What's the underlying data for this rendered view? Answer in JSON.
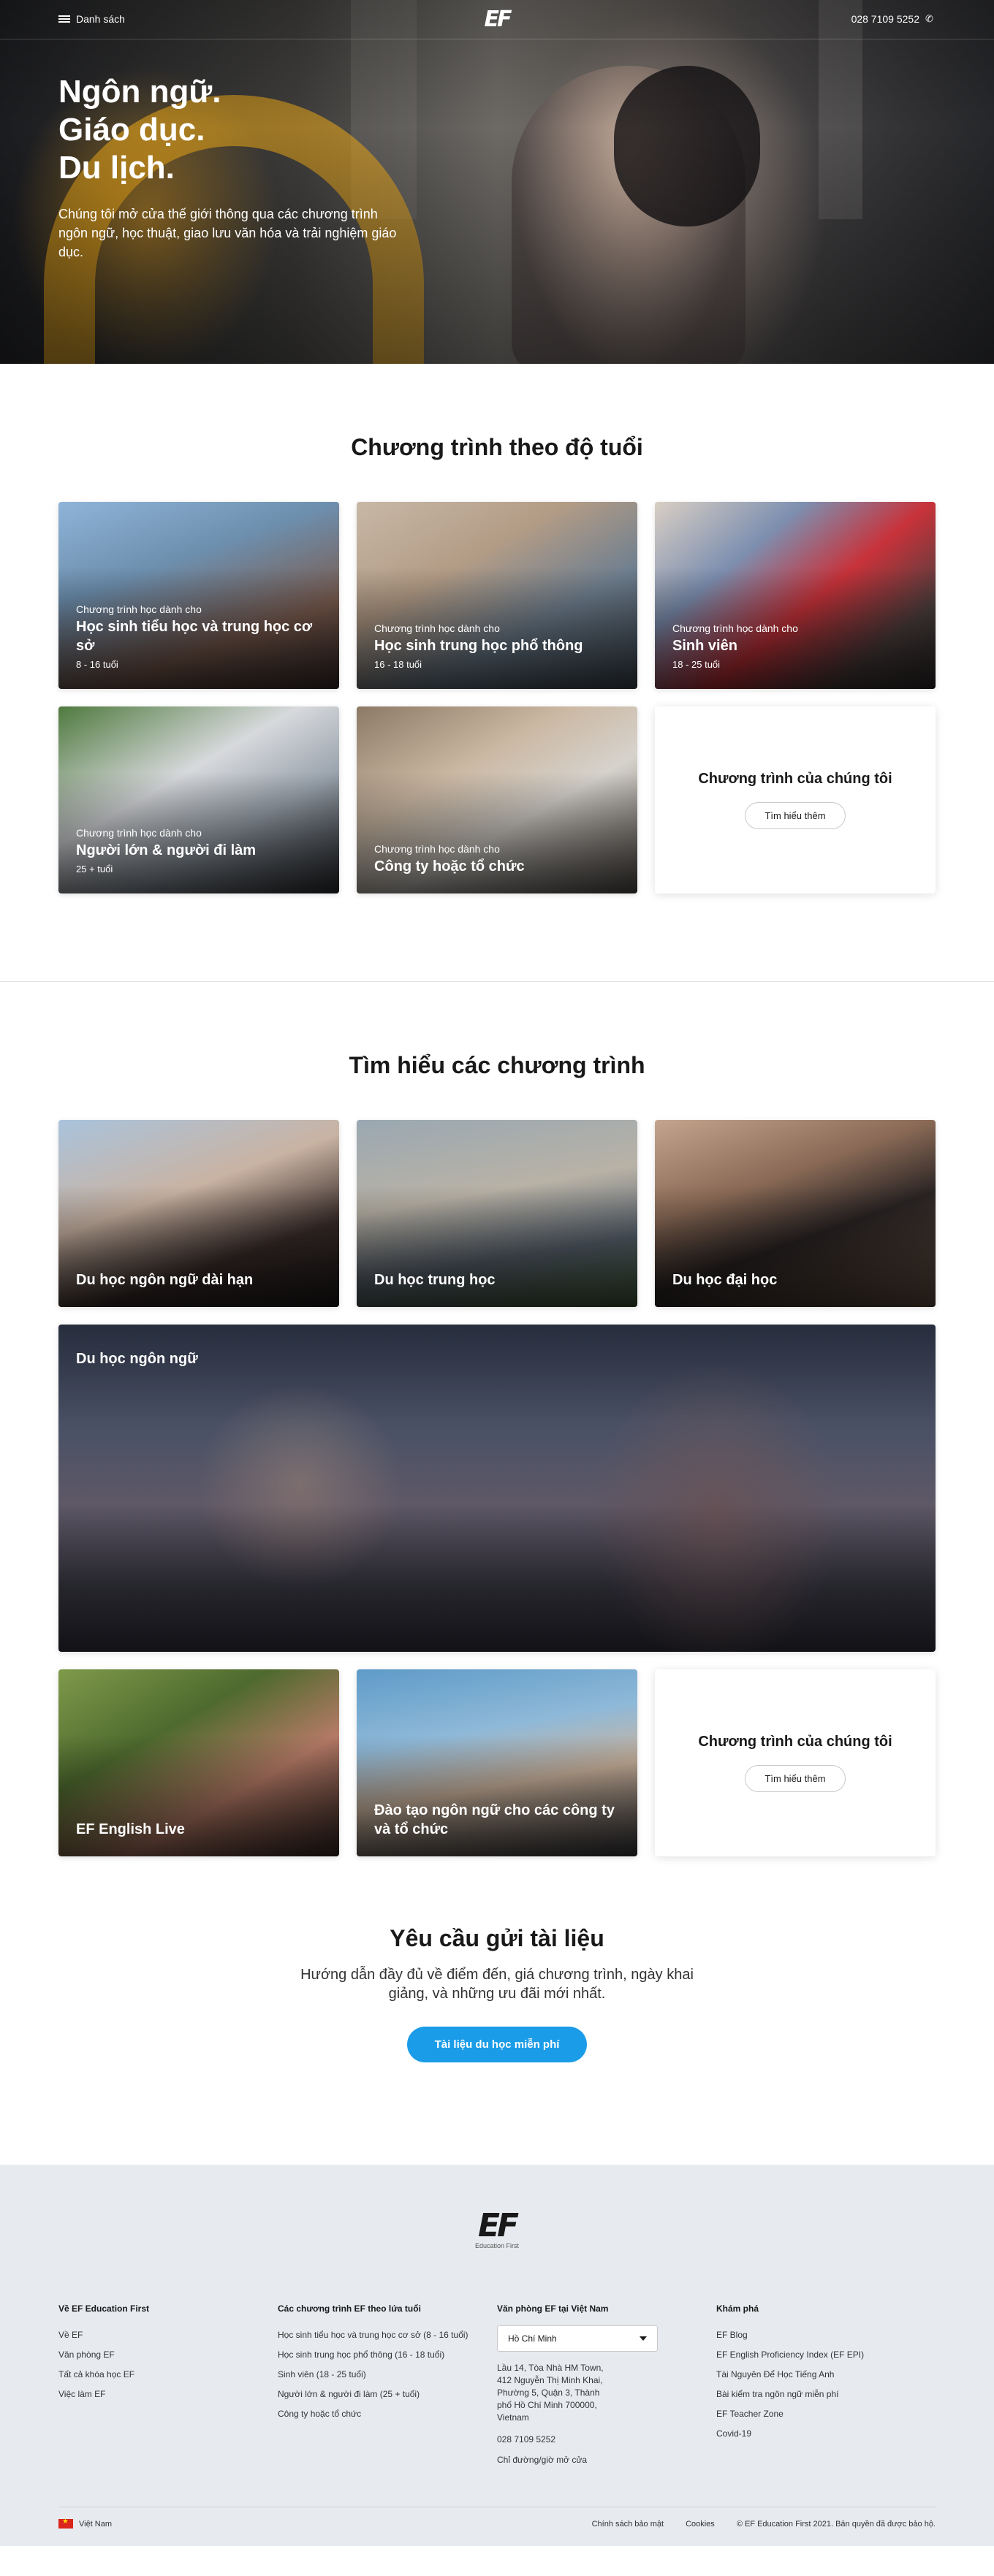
{
  "nav": {
    "menu_label": "Danh sách",
    "logo": "EF",
    "phone": "028 7109 5252"
  },
  "hero": {
    "title_lines": [
      "Ngôn ngữ.",
      "Giáo dục.",
      "Du lịch."
    ],
    "subtitle": "Chúng tôi mở cửa thế giới thông qua các chương trình ngôn ngữ, học thuật, giao lưu văn hóa và trải nghiệm giáo dục."
  },
  "age_programs": {
    "title": "Chương trình theo độ tuổi",
    "cards": [
      {
        "kicker": "Chương trình học dành cho",
        "title": "Học sinh tiểu học và trung học cơ sở",
        "age": "8 - 16 tuổi"
      },
      {
        "kicker": "Chương trình học dành cho",
        "title": "Học sinh trung học phổ thông",
        "age": "16 - 18 tuổi"
      },
      {
        "kicker": "Chương trình học dành cho",
        "title": "Sinh viên",
        "age": "18 - 25 tuổi"
      },
      {
        "kicker": "Chương trình học dành cho",
        "title": "Người lớn & người đi làm",
        "age": "25 + tuổi"
      },
      {
        "kicker": "Chương trình học dành cho",
        "title": "Công ty hoặc tổ chức",
        "age": ""
      }
    ],
    "cta_card": {
      "title": "Chương trình của chúng tôi",
      "button": "Tìm hiểu thêm"
    }
  },
  "explore": {
    "title": "Tìm hiểu các chương trình",
    "cards": [
      {
        "title": "Du học ngôn ngữ dài hạn"
      },
      {
        "title": "Du học trung học"
      },
      {
        "title": "Du học đại học"
      }
    ],
    "wide_card": {
      "title": "Du học ngôn ngữ"
    },
    "bottom_cards": [
      {
        "title": "EF English Live"
      },
      {
        "title": "Đào tạo ngôn ngữ cho các công ty và tổ chức"
      }
    ],
    "cta_card": {
      "title": "Chương trình của chúng tôi",
      "button": "Tìm hiểu thêm"
    }
  },
  "brochure": {
    "title": "Yêu cầu gửi tài liệu",
    "subtitle": "Hướng dẫn đầy đủ về điểm đến, giá chương trình, ngày khai giảng, và những ưu đãi mới nhất.",
    "button": "Tài liệu du học miễn phí"
  },
  "footer": {
    "logo": "EF",
    "logo_tag": "Education First",
    "col1": {
      "head": "Về EF Education First",
      "links": [
        "Về EF",
        "Văn phòng EF",
        "Tất cả khóa học EF",
        "Việc làm EF"
      ]
    },
    "col2": {
      "head": "Các chương trình EF theo lứa tuổi",
      "links": [
        "Học sinh tiểu học và trung học cơ sở (8 - 16 tuổi)",
        "Học sinh trung học phổ thông (16 - 18 tuổi)",
        "Sinh viên (18 - 25 tuổi)",
        "Người lớn & người đi làm (25 + tuổi)",
        "Công ty hoặc tổ chức"
      ]
    },
    "col3": {
      "head": "Văn phòng EF tại Việt Nam",
      "select": "Hồ Chí Minh",
      "address": "Lầu 14, Tòa Nhà HM Town, 412 Nguyễn Thị Minh Khai, Phường 5, Quận 3, Thành phố Hồ Chí Minh 700000, Vietnam",
      "phone": "028 7109 5252",
      "directions": "Chỉ đường/giờ mở cửa"
    },
    "col4": {
      "head": "Khám phá",
      "links": [
        "EF Blog",
        "EF English Proficiency Index (EF EPI)",
        "Tài Nguyên Để Học Tiếng Anh",
        "Bài kiểm tra ngôn ngữ miễn phí",
        "EF Teacher Zone",
        "Covid-19"
      ]
    },
    "country": "Việt Nam",
    "privacy": "Chính sách bảo mật",
    "cookies": "Cookies",
    "copyright": "© EF Education First 2021. Bản quyền đã được bảo hộ."
  },
  "colors": {
    "accent_blue": "#1b9ce8",
    "footer_bg": "#e7ebf0"
  }
}
